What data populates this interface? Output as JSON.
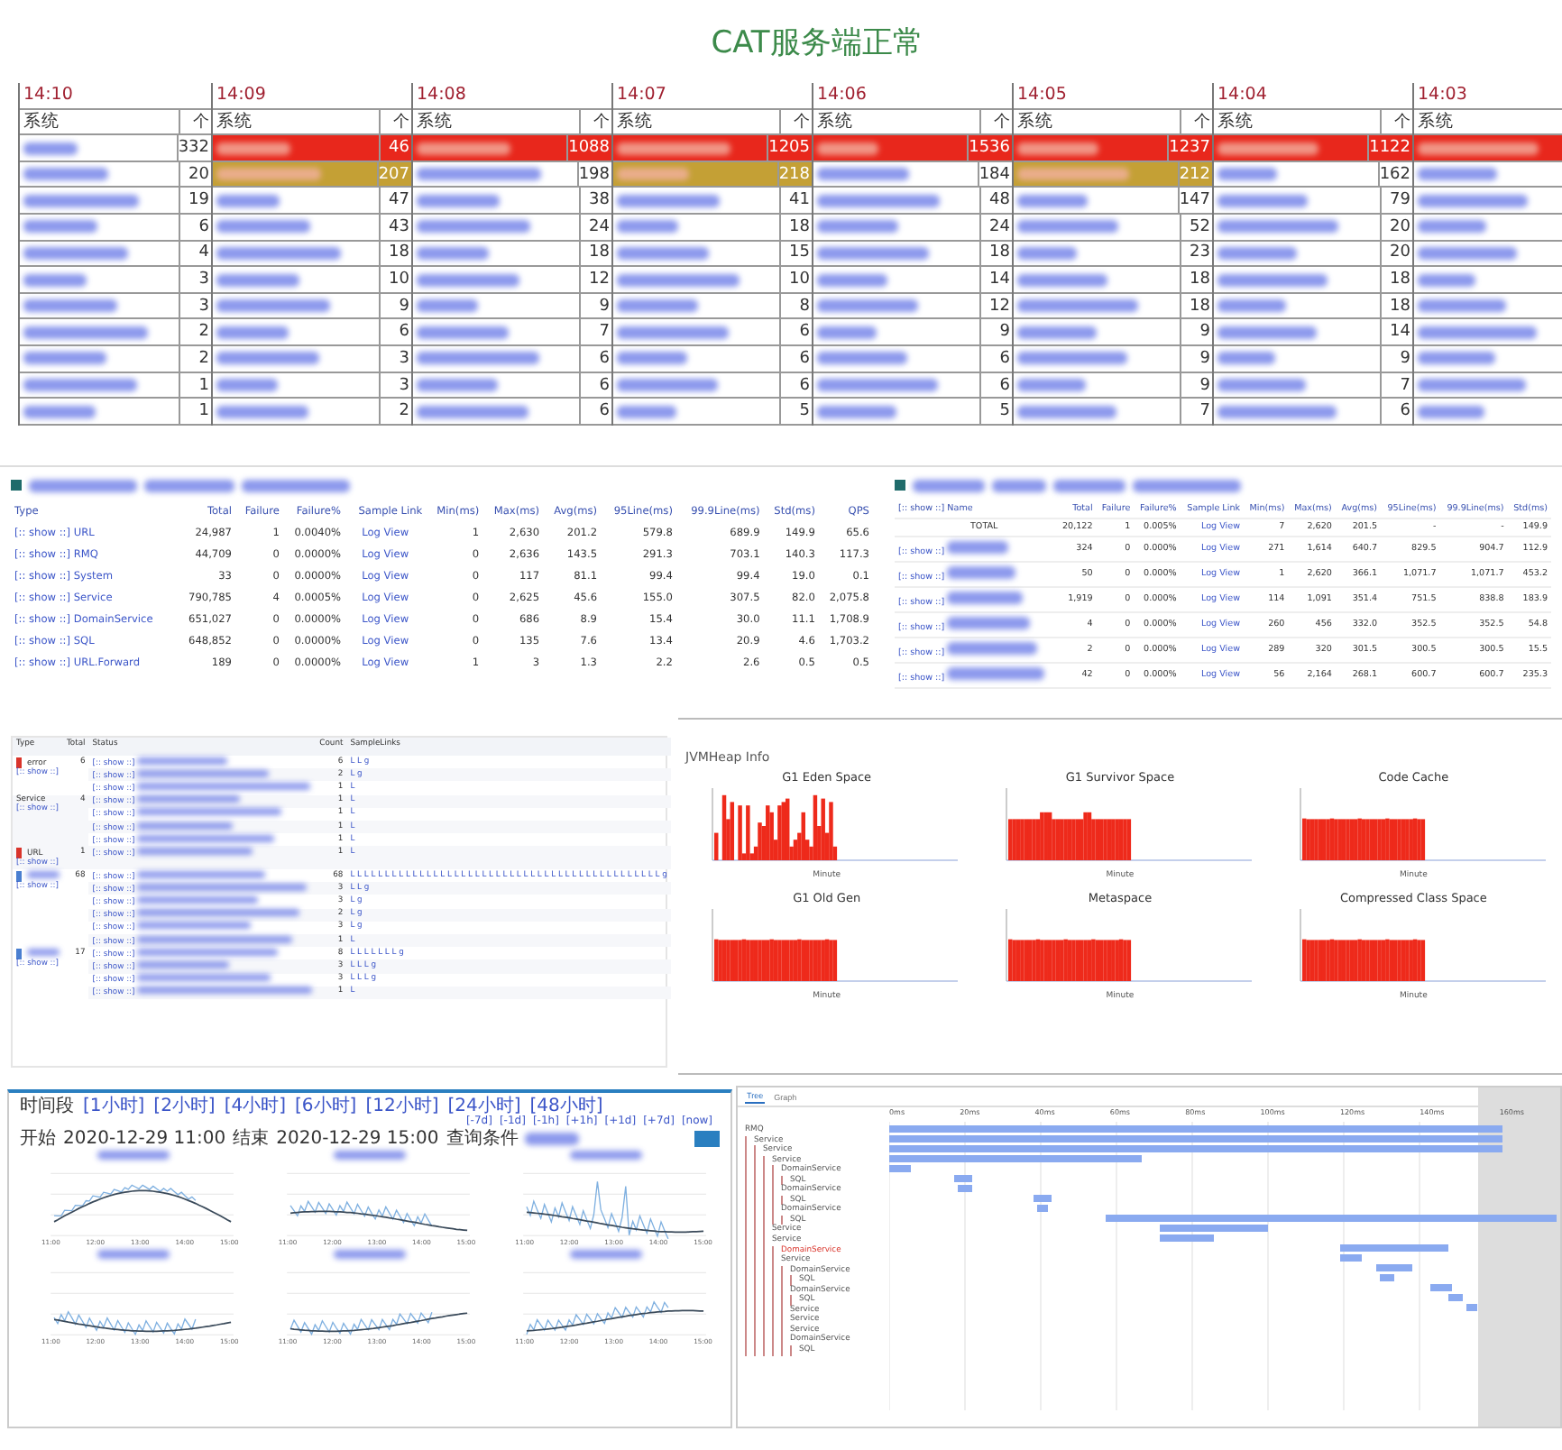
{
  "title": "CAT服务端正常",
  "minute_table": {
    "columns": [
      {
        "time": "14:10",
        "name_header": "系统",
        "count_header": "个",
        "cells": [
          {
            "count": "332"
          },
          {
            "count": "20"
          },
          {
            "count": "19"
          },
          {
            "count": "6"
          },
          {
            "count": "4"
          },
          {
            "count": "3"
          },
          {
            "count": "3"
          },
          {
            "count": "2"
          },
          {
            "count": "2"
          },
          {
            "count": "1"
          },
          {
            "count": "1"
          }
        ]
      },
      {
        "time": "14:09",
        "name_header": "系统",
        "count_header": "个",
        "cells": [
          {
            "count": "46",
            "color": "#e8271c"
          },
          {
            "count": "207",
            "color": "#c4a035"
          },
          {
            "count": "47"
          },
          {
            "count": "43"
          },
          {
            "count": "18"
          },
          {
            "count": "10"
          },
          {
            "count": "9"
          },
          {
            "count": "6"
          },
          {
            "count": "3"
          },
          {
            "count": "3"
          },
          {
            "count": "2"
          }
        ]
      },
      {
        "time": "14:08",
        "name_header": "系统",
        "count_header": "个",
        "cells": [
          {
            "count": "1088",
            "color": "#e8271c"
          },
          {
            "count": "198"
          },
          {
            "count": "38"
          },
          {
            "count": "24"
          },
          {
            "count": "18"
          },
          {
            "count": "12"
          },
          {
            "count": "9"
          },
          {
            "count": "7"
          },
          {
            "count": "6"
          },
          {
            "count": "6"
          },
          {
            "count": "6"
          }
        ]
      },
      {
        "time": "14:07",
        "name_header": "系统",
        "count_header": "个",
        "cells": [
          {
            "count": "1205",
            "color": "#e8271c"
          },
          {
            "count": "218",
            "color": "#c4a035"
          },
          {
            "count": "41"
          },
          {
            "count": "18"
          },
          {
            "count": "15"
          },
          {
            "count": "10"
          },
          {
            "count": "8"
          },
          {
            "count": "6"
          },
          {
            "count": "6"
          },
          {
            "count": "6"
          },
          {
            "count": "5"
          }
        ]
      },
      {
        "time": "14:06",
        "name_header": "系统",
        "count_header": "个",
        "cells": [
          {
            "count": "1536",
            "color": "#e8271c"
          },
          {
            "count": "184"
          },
          {
            "count": "48"
          },
          {
            "count": "24"
          },
          {
            "count": "18"
          },
          {
            "count": "14"
          },
          {
            "count": "12"
          },
          {
            "count": "9"
          },
          {
            "count": "6"
          },
          {
            "count": "6"
          },
          {
            "count": "5"
          }
        ]
      },
      {
        "time": "14:05",
        "name_header": "系统",
        "count_header": "个",
        "cells": [
          {
            "count": "1237",
            "color": "#e8271c"
          },
          {
            "count": "212",
            "color": "#c4a035"
          },
          {
            "count": "147"
          },
          {
            "count": "52"
          },
          {
            "count": "23"
          },
          {
            "count": "18"
          },
          {
            "count": "18"
          },
          {
            "count": "9"
          },
          {
            "count": "9"
          },
          {
            "count": "9"
          },
          {
            "count": "7"
          }
        ]
      },
      {
        "time": "14:04",
        "name_header": "系统",
        "count_header": "个",
        "cells": [
          {
            "count": "1122",
            "color": "#e8271c"
          },
          {
            "count": "162"
          },
          {
            "count": "79"
          },
          {
            "count": "20"
          },
          {
            "count": "20"
          },
          {
            "count": "18"
          },
          {
            "count": "18"
          },
          {
            "count": "14"
          },
          {
            "count": "9"
          },
          {
            "count": "7"
          },
          {
            "count": "6"
          }
        ]
      },
      {
        "time": "14:03",
        "name_header": "系统",
        "cells": [
          {
            "color": "#e8271c"
          }
        ]
      }
    ]
  },
  "type_report": {
    "columns": [
      "Type",
      "Total",
      "Failure",
      "Failure%",
      "Sample Link",
      "Min(ms)",
      "Max(ms)",
      "Avg(ms)",
      "95Line(ms)",
      "99.9Line(ms)",
      "Std(ms)",
      "QPS"
    ],
    "rows": [
      {
        "show": "[:: show ::]",
        "type": "URL",
        "before": [
          "24,987",
          "1",
          "0.0040%"
        ],
        "sample": "Log View",
        "after": [
          "1",
          "2,630",
          "201.2",
          "579.8",
          "689.9",
          "149.9",
          "65.6"
        ]
      },
      {
        "show": "[:: show ::]",
        "type": "RMQ",
        "before": [
          "44,709",
          "0",
          "0.0000%"
        ],
        "sample": "Log View",
        "after": [
          "0",
          "2,636",
          "143.5",
          "291.3",
          "703.1",
          "140.3",
          "117.3"
        ]
      },
      {
        "show": "[:: show ::]",
        "type": "System",
        "before": [
          "33",
          "0",
          "0.0000%"
        ],
        "sample": "Log View",
        "after": [
          "0",
          "117",
          "81.1",
          "99.4",
          "99.4",
          "19.0",
          "0.1"
        ]
      },
      {
        "show": "[:: show ::]",
        "type": "Service",
        "before": [
          "790,785",
          "4",
          "0.0005%"
        ],
        "sample": "Log View",
        "after": [
          "0",
          "2,625",
          "45.6",
          "155.0",
          "307.5",
          "82.0",
          "2,075.8"
        ]
      },
      {
        "show": "[:: show ::]",
        "type": "DomainService",
        "before": [
          "651,027",
          "0",
          "0.0000%"
        ],
        "sample": "Log View",
        "after": [
          "0",
          "686",
          "8.9",
          "15.4",
          "30.0",
          "11.1",
          "1,708.9"
        ]
      },
      {
        "show": "[:: show ::]",
        "type": "SQL",
        "before": [
          "648,852",
          "0",
          "0.0000%"
        ],
        "sample": "Log View",
        "after": [
          "0",
          "135",
          "7.6",
          "13.4",
          "20.9",
          "4.6",
          "1,703.2"
        ]
      },
      {
        "show": "[:: show ::]",
        "type": "URL.Forward",
        "before": [
          "189",
          "0",
          "0.0000%"
        ],
        "sample": "Log View",
        "after": [
          "1",
          "3",
          "1.3",
          "2.2",
          "2.6",
          "0.5",
          "0.5"
        ]
      }
    ]
  },
  "name_report": {
    "columns": [
      "[:: show ::] Name",
      "Total",
      "Failure",
      "Failure%",
      "Sample Link",
      "Min(ms)",
      "Max(ms)",
      "Avg(ms)",
      "95Line(ms)",
      "99.9Line(ms)",
      "Std(ms)"
    ],
    "rows": [
      {
        "name": "TOTAL",
        "name_hidden": false,
        "before": [
          "20,122",
          "1",
          "0.005%"
        ],
        "sample": "Log View",
        "after": [
          "7",
          "2,620",
          "201.5",
          "-",
          "-",
          "149.9"
        ]
      },
      {
        "show": "[:: show ::]",
        "name_hidden": true,
        "before": [
          "324",
          "0",
          "0.000%"
        ],
        "sample": "Log View",
        "after": [
          "271",
          "1,614",
          "640.7",
          "829.5",
          "904.7",
          "112.9"
        ]
      },
      {
        "show": "[:: show ::]",
        "name_hidden": true,
        "before": [
          "50",
          "0",
          "0.000%"
        ],
        "sample": "Log View",
        "after": [
          "1",
          "2,620",
          "366.1",
          "1,071.7",
          "1,071.7",
          "453.2"
        ]
      },
      {
        "show": "[:: show ::]",
        "name_hidden": true,
        "before": [
          "1,919",
          "0",
          "0.000%"
        ],
        "sample": "Log View",
        "after": [
          "114",
          "1,091",
          "351.4",
          "751.5",
          "838.8",
          "183.9"
        ]
      },
      {
        "show": "[:: show ::]",
        "name_hidden": true,
        "before": [
          "4",
          "0",
          "0.000%"
        ],
        "sample": "Log View",
        "after": [
          "260",
          "456",
          "332.0",
          "352.5",
          "352.5",
          "54.8"
        ]
      },
      {
        "show": "[:: show ::]",
        "name_hidden": true,
        "before": [
          "2",
          "0",
          "0.000%"
        ],
        "sample": "Log View",
        "after": [
          "289",
          "320",
          "301.5",
          "300.5",
          "300.5",
          "15.5"
        ]
      },
      {
        "show": "[:: show ::]",
        "name_hidden": true,
        "before": [
          "42",
          "0",
          "0.000%"
        ],
        "sample": "Log View",
        "after": [
          "56",
          "2,164",
          "268.1",
          "600.7",
          "600.7",
          "235.3"
        ]
      }
    ]
  },
  "problem_report": {
    "columns": [
      "Type",
      "Total",
      "Status",
      "Count",
      "SampleLinks"
    ],
    "groups": [
      {
        "type": "error",
        "color": "#d9342b",
        "total": "6",
        "show": "[:: show ::]",
        "rows": [
          {
            "show": "[:: show ::]",
            "count": "6",
            "links": "L L g"
          },
          {
            "show": "[:: show ::]",
            "count": "2",
            "links": "L g"
          },
          {
            "show": "[:: show ::]",
            "count": "1",
            "links": "L"
          }
        ]
      },
      {
        "type": "Service",
        "total": "4",
        "show": "[:: show ::]",
        "rows": [
          {
            "show": "[:: show ::]",
            "count": "1",
            "links": "L"
          },
          {
            "show": "[:: show ::]",
            "count": "1",
            "links": "L"
          },
          {
            "show": "[:: show ::]",
            "count": "1",
            "links": "L"
          },
          {
            "show": "[:: show ::]",
            "count": "1",
            "links": "L"
          }
        ]
      },
      {
        "type": "URL",
        "color": "#d9342b",
        "total": "1",
        "show": "[:: show ::]",
        "rows": [
          {
            "show": "[:: show ::]",
            "count": "1",
            "links": "L"
          }
        ]
      },
      {
        "color": "#4a7fd0",
        "total": "68",
        "show": "[:: show ::]",
        "rows": [
          {
            "show": "[:: show ::]",
            "count": "68",
            "links": "L L L L L L L L L L L L L L L L L L L L L L L L L L L L L L L L L L L L L L L L L L L L L g"
          },
          {
            "show": "[:: show ::]",
            "count": "3",
            "links": "L L g"
          },
          {
            "show": "[:: show ::]",
            "count": "3",
            "links": "L g"
          },
          {
            "show": "[:: show ::]",
            "count": "2",
            "links": "L g"
          },
          {
            "show": "[:: show ::]",
            "count": "3",
            "links": "L g"
          },
          {
            "show": "[:: show ::]",
            "count": "1",
            "links": "L"
          }
        ]
      },
      {
        "color": "#4a7fd0",
        "total": "17",
        "show": "[:: show ::]",
        "rows": [
          {
            "show": "[:: show ::]",
            "count": "8",
            "links": "L L L L L L L g"
          },
          {
            "show": "[:: show ::]",
            "count": "3",
            "links": "L L L g"
          },
          {
            "show": "[:: show ::]",
            "count": "3",
            "links": "L L L g"
          },
          {
            "show": "[:: show ::]",
            "count": "1",
            "links": "L"
          }
        ]
      }
    ]
  },
  "heap": {
    "title": "JVMHeap Info",
    "charts": [
      {
        "title": "G1 Eden Space",
        "kind": "spiky",
        "xlabel": "Minute"
      },
      {
        "title": "G1 Survivor Space",
        "kind": "step",
        "xlabel": "Minute"
      },
      {
        "title": "Code Cache",
        "kind": "flat",
        "xlabel": "Minute"
      },
      {
        "title": "G1 Old Gen",
        "kind": "flat",
        "xlabel": "Minute"
      },
      {
        "title": "Metaspace",
        "kind": "flat",
        "xlabel": "Minute"
      },
      {
        "title": "Compressed Class Space",
        "kind": "flat",
        "xlabel": "Minute"
      }
    ]
  },
  "trend": {
    "range_label": "时间段",
    "ranges": [
      "[1小时]",
      "[2小时]",
      "[4小时]",
      "[6小时]",
      "[12小时]",
      "[24小时]",
      "[48小时]"
    ],
    "shifts": [
      "[-7d]",
      "[-1d]",
      "[-1h]",
      "[+1h]",
      "[+1d]",
      "[+7d]",
      "[now]"
    ],
    "start_label": "开始",
    "start": "2020-12-29 11:00",
    "end_label": "结束",
    "end": "2020-12-29 15:00",
    "query_label": "查询条件",
    "charts": [
      {
        "kind": "smooth",
        "x_ticks": [
          "11:00",
          "12:00",
          "13:00",
          "14:00",
          "15:00"
        ]
      },
      {
        "kind": "noisy",
        "x_ticks": [
          "11:00",
          "12:00",
          "13:00",
          "14:00",
          "15:00"
        ]
      },
      {
        "kind": "spiky",
        "x_ticks": [
          "11:00",
          "12:00",
          "13:00",
          "14:00",
          "15:00"
        ]
      },
      {
        "kind": "noisy",
        "x_ticks": [
          "11:00",
          "12:00",
          "13:00",
          "14:00",
          "15:00"
        ]
      },
      {
        "kind": "noisy",
        "x_ticks": [
          "11:00",
          "12:00",
          "13:00",
          "14:00",
          "15:00"
        ]
      },
      {
        "kind": "noisy",
        "x_ticks": [
          "11:00",
          "12:00",
          "13:00",
          "14:00",
          "15:00"
        ]
      }
    ]
  },
  "trace": {
    "tabs": [
      {
        "label": "Tree",
        "selected": true
      },
      {
        "label": "Graph",
        "selected": false
      }
    ],
    "ticks": [
      "0ms",
      "20ms",
      "40ms",
      "60ms",
      "80ms",
      "100ms",
      "120ms",
      "140ms",
      "160ms"
    ],
    "tree": [
      {
        "label": "RMQ",
        "error": false,
        "children": [
          {
            "label": "Service",
            "error": false,
            "children": [
              {
                "label": "Service",
                "error": false,
                "children": [
                  {
                    "label": "Service",
                    "error": false,
                    "children": [
                      {
                        "label": "DomainService",
                        "error": false,
                        "children": [
                          {
                            "label": "SQL",
                            "error": false
                          }
                        ]
                      },
                      {
                        "label": "DomainService",
                        "error": false,
                        "children": [
                          {
                            "label": "SQL",
                            "error": false
                          }
                        ]
                      },
                      {
                        "label": "DomainService",
                        "error": false,
                        "children": [
                          {
                            "label": "SQL",
                            "error": false
                          }
                        ]
                      }
                    ]
                  },
                  {
                    "label": "Service",
                    "error": false
                  },
                  {
                    "label": "Service",
                    "error": false,
                    "children": [
                      {
                        "label": "DomainService",
                        "error": true
                      },
                      {
                        "label": "Service",
                        "error": false,
                        "children": [
                          {
                            "label": "DomainService",
                            "error": false,
                            "children": [
                              {
                                "label": "SQL",
                                "error": false
                              }
                            ]
                          },
                          {
                            "label": "DomainService",
                            "error": false,
                            "children": [
                              {
                                "label": "SQL",
                                "error": false
                              }
                            ]
                          },
                          {
                            "label": "Service",
                            "error": false
                          },
                          {
                            "label": "Service",
                            "error": false
                          },
                          {
                            "label": "Service",
                            "error": false
                          },
                          {
                            "label": "DomainService",
                            "error": false,
                            "children": [
                              {
                                "label": "SQL",
                                "error": false
                              }
                            ]
                          }
                        ]
                      }
                    ]
                  }
                ]
              }
            ]
          }
        ]
      }
    ]
  }
}
